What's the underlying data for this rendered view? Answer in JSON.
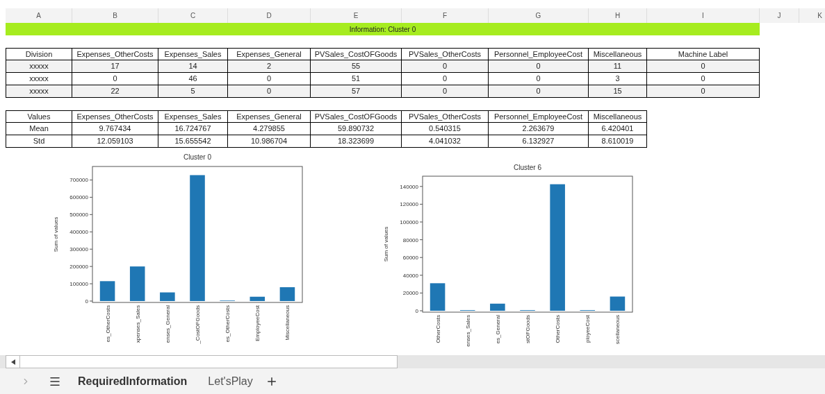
{
  "column_headers": [
    "A",
    "B",
    "C",
    "D",
    "E",
    "F",
    "G",
    "H",
    "I",
    "J",
    "K"
  ],
  "banner": "Information: Cluster 0",
  "data_table": {
    "columns": [
      "Division",
      "Expenses_OtherCosts",
      "Expenses_Sales",
      "Expenses_General",
      "PVSales_CostOFGoods",
      "PVSales_OtherCosts",
      "Personnel_EmployeeCost",
      "Miscellaneous",
      "Machine Label"
    ],
    "rows": [
      [
        "xxxxx",
        "17",
        "14",
        "2",
        "55",
        "0",
        "0",
        "11",
        "0"
      ],
      [
        "xxxxx",
        "0",
        "46",
        "0",
        "51",
        "0",
        "0",
        "3",
        "0"
      ],
      [
        "xxxxx",
        "22",
        "5",
        "0",
        "57",
        "0",
        "0",
        "15",
        "0"
      ]
    ]
  },
  "stats_table": {
    "columns": [
      "Values",
      "Expenses_OtherCosts",
      "Expenses_Sales",
      "Expenses_General",
      "PVSales_CostOFGoods",
      "PVSales_OtherCosts",
      "Personnel_EmployeeCost",
      "Miscellaneous"
    ],
    "rows": [
      [
        "Mean",
        "9.767434",
        "16.724767",
        "4.279855",
        "59.890732",
        "0.540315",
        "2.263679",
        "6.420401"
      ],
      [
        "Std",
        "12.059103",
        "15.655542",
        "10.986704",
        "18.323699",
        "4.041032",
        "6.132927",
        "8.610019"
      ]
    ]
  },
  "charts": [
    {
      "chart_data": {
        "type": "bar",
        "title": "Cluster 0",
        "ylabel": "Sum of values",
        "categories": [
          "es_OtherCosts",
          "xpenses_Sales",
          "enses_General",
          "_CostOFGoods",
          "es_OtherCosts",
          "EmployeeCost",
          "Miscellaneous"
        ],
        "series": [
          {
            "color": "#1f77b4",
            "values": [
              115000,
              200000,
              50000,
              728000,
              3000,
              25000,
              80000
            ]
          }
        ],
        "ylim": [
          0,
          770000
        ],
        "yticks": [
          0,
          100000,
          200000,
          300000,
          400000,
          500000,
          600000,
          700000
        ]
      }
    },
    {
      "chart_data": {
        "type": "bar",
        "title": "Cluster 6",
        "ylabel": "Sum of values",
        "categories": [
          "OtherCosts",
          "enses_Sales",
          "es_General",
          "stOFGoods",
          "OtherCosts",
          "ployeeCost",
          "scellaneous"
        ],
        "series": [
          {
            "color": "#1f77b4",
            "values": [
              31000,
              700,
              8000,
              700,
              142500,
              700,
              16000
            ]
          }
        ],
        "ylim": [
          0,
          150000
        ],
        "yticks": [
          0,
          20000,
          40000,
          60000,
          80000,
          100000,
          120000,
          140000
        ]
      }
    }
  ],
  "sheet_tabs": [
    {
      "label": "RequiredInformation",
      "selected": true
    },
    {
      "label": "Let'sPlay",
      "selected": false
    }
  ]
}
